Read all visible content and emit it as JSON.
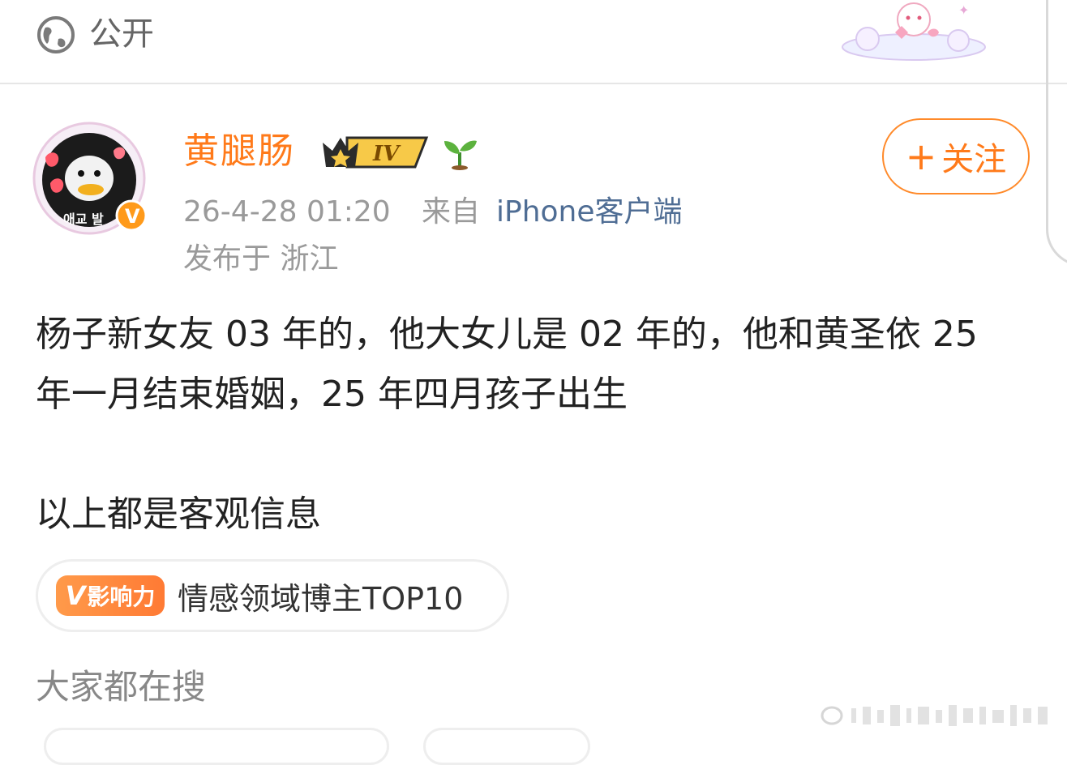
{
  "visibility": {
    "label": "公开",
    "icon": "globe-icon"
  },
  "author": {
    "name": "黄腿肠",
    "avatar_text": "애교 발",
    "level_badge": "IV",
    "verified_mark": "V"
  },
  "post_meta": {
    "time": "26-4-28 01:20",
    "from_label": "来自",
    "source": "iPhone客户端",
    "location": "发布于 浙江"
  },
  "follow_button": {
    "plus": "+",
    "label": "关注"
  },
  "post": {
    "paragraphs": [
      "杨子新女友 03 年的，他大女儿是 02 年的，他和黄圣依 25 年一月结束婚姻，25 年四月孩子出生",
      "以上都是客观信息"
    ]
  },
  "influence": {
    "badge_v": "V",
    "badge_text": "影响力",
    "label": "情感领域博主TOP10"
  },
  "search_section": {
    "title": "大家都在搜"
  },
  "colors": {
    "accent_orange": "#ff7a1a",
    "link_blue": "#4f6d94",
    "meta_gray": "#9a9a9a"
  }
}
